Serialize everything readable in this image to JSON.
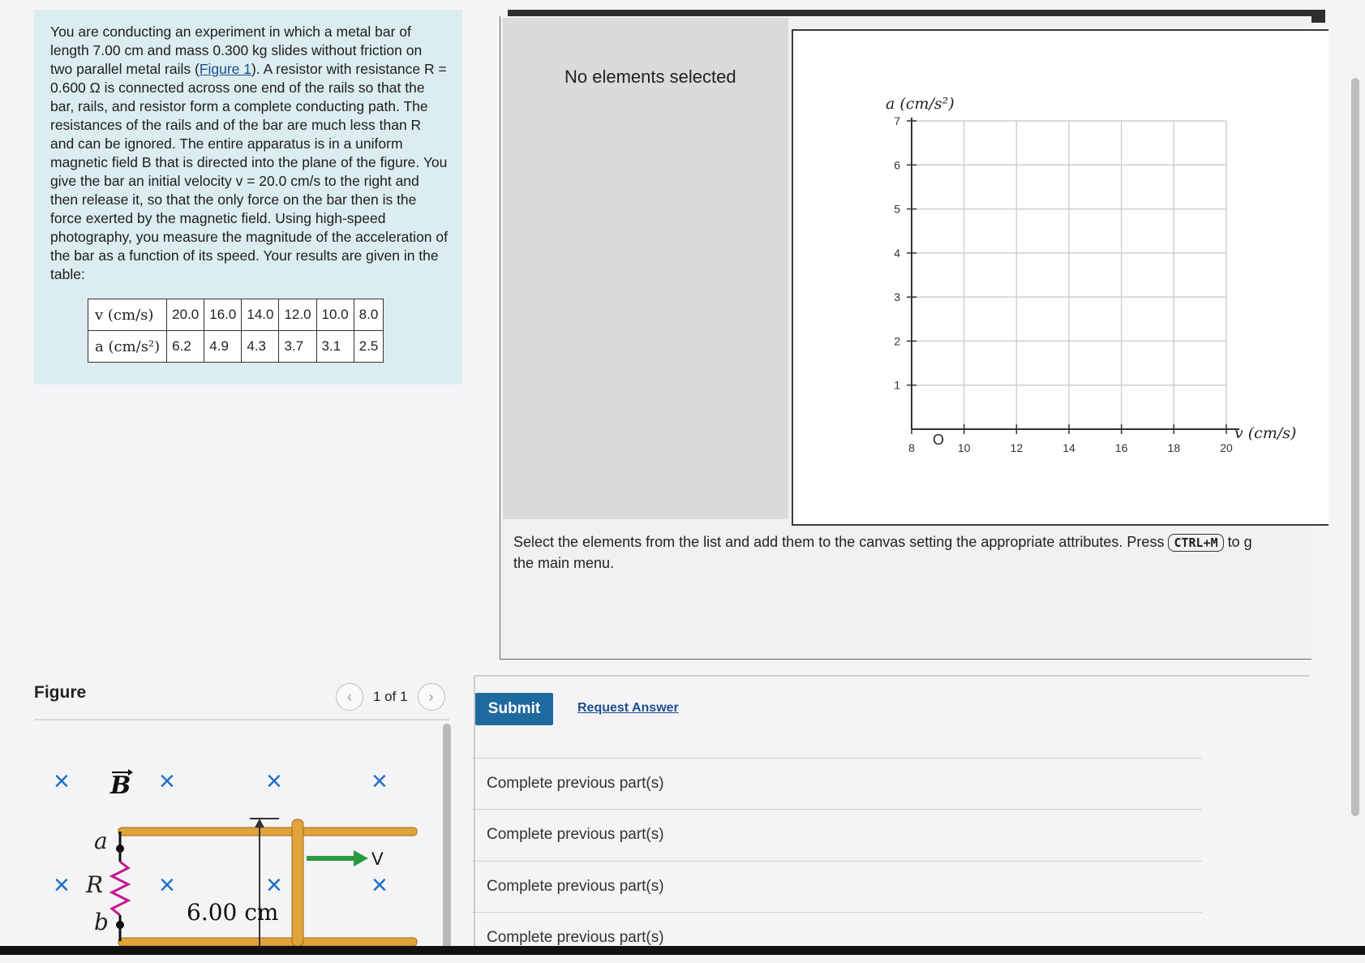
{
  "problem": {
    "p1": "You are conducting an experiment in which a metal bar of length 7.00 cm and mass 0.300 kg slides without friction on two parallel metal rails (",
    "figure_link": "Figure 1",
    "p2": "). A resistor with resistance R = 0.600 Ω is connected across one end of the rails so that the bar, rails, and resistor form a complete conducting path. The resistances of the rails and of the bar are much less than R and can be ignored. The entire apparatus is in a uniform magnetic field B that is directed into the plane of the figure. You give the bar an initial velocity v = 20.0 cm/s to the right and then release it, so that the only force on the bar then is the force exerted by the magnetic field. Using high-speed photography, you measure the magnitude of the acceleration of the bar as a function of its speed. Your results are given in the table:",
    "table": {
      "row1_label": "v (cm/s)",
      "row2_label": "a (cm/s²)",
      "v": [
        "20.0",
        "16.0",
        "14.0",
        "12.0",
        "10.0",
        "8.0"
      ],
      "a": [
        "6.2",
        "4.9",
        "4.3",
        "3.7",
        "3.1",
        "2.5"
      ]
    }
  },
  "figure": {
    "title": "Figure",
    "pager": "1 of 1",
    "labels": {
      "B": "B",
      "a": "a",
      "b": "b",
      "R": "R",
      "v": "V",
      "length": "6.00 cm",
      "x": "×"
    }
  },
  "palette": {
    "message": "No elements selected"
  },
  "graph": {
    "y_label": "a (cm/s²)",
    "x_label": "v (cm/s)",
    "origin_label": "O",
    "y_ticks": [
      "1",
      "2",
      "3",
      "4",
      "5",
      "6",
      "7"
    ],
    "x_ticks": [
      "8",
      "10",
      "12",
      "14",
      "16",
      "18",
      "20"
    ]
  },
  "instructions": {
    "before_key": "Select the elements from the list and add them to the canvas setting the appropriate attributes. Press",
    "key": "CTRL+M",
    "after_key": "to g",
    "line2": "the main menu."
  },
  "actions": {
    "submit": "Submit",
    "request": "Request Answer"
  },
  "parts": [
    "Complete previous part(s)",
    "Complete previous part(s)",
    "Complete previous part(s)",
    "Complete previous part(s)"
  ],
  "colors": {
    "panel": "#dcedf0",
    "submit": "#1e6a9e",
    "cross": "#1f6fc4",
    "rail": "#e0a43a",
    "arrow": "#2a9a45"
  }
}
